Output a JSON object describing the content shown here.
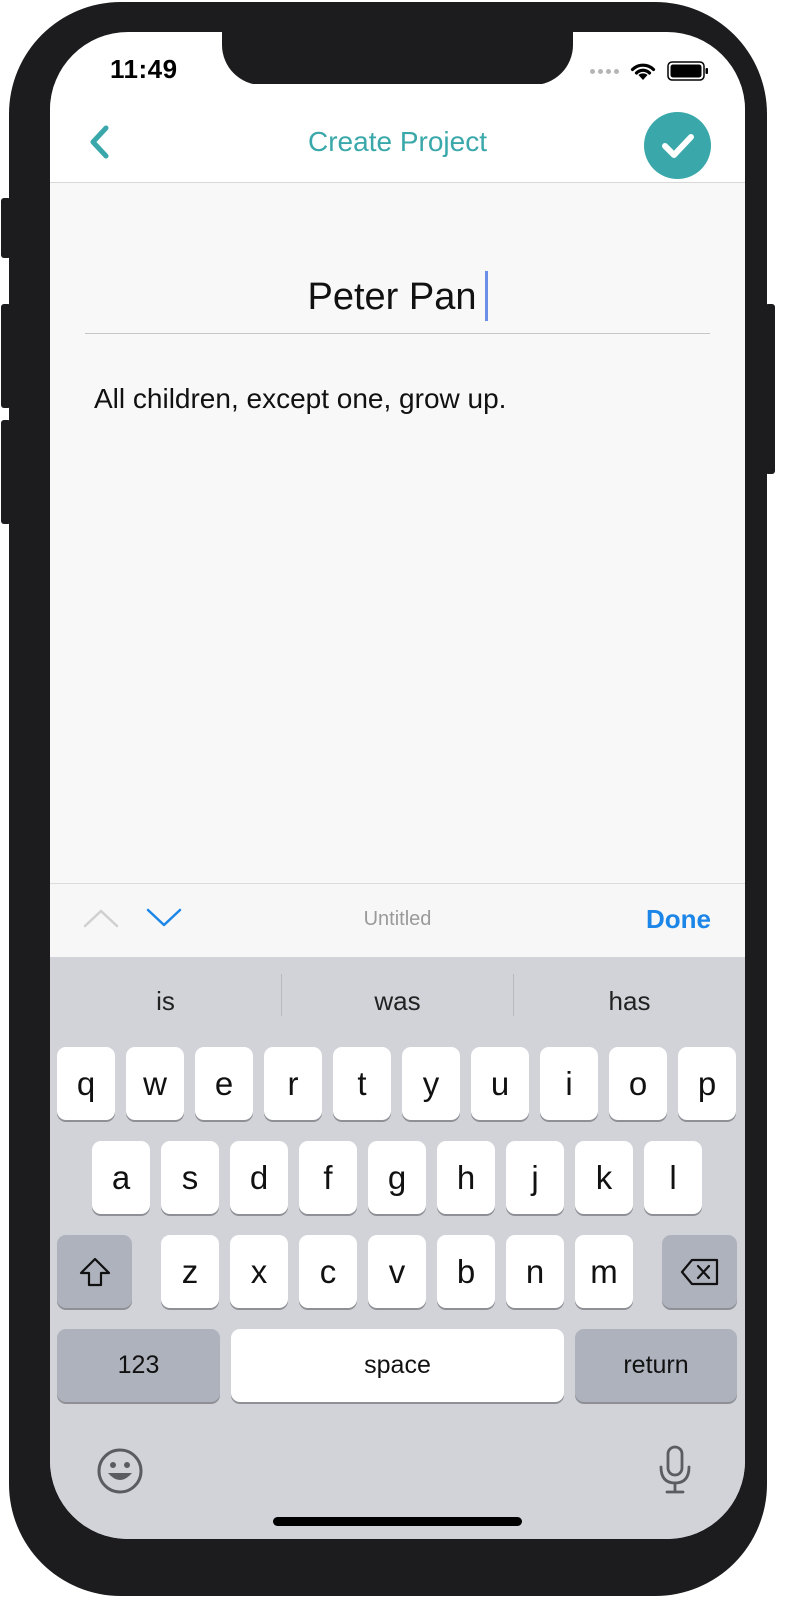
{
  "status_bar": {
    "time": "11:49"
  },
  "nav": {
    "title": "Create Project",
    "back_icon": "chevron-left-icon",
    "confirm_icon": "checkmark-icon"
  },
  "colors": {
    "accent": "#3aa8aa",
    "done_blue": "#1c86e8",
    "caret": "#6b8fe6"
  },
  "editor": {
    "title_value": "Peter Pan",
    "body_value": "All children, except one, grow up."
  },
  "accessory_bar": {
    "label": "Untitled",
    "done_label": "Done"
  },
  "keyboard": {
    "suggestions": [
      "is",
      "was",
      "has"
    ],
    "row1": [
      "q",
      "w",
      "e",
      "r",
      "t",
      "y",
      "u",
      "i",
      "o",
      "p"
    ],
    "row2": [
      "a",
      "s",
      "d",
      "f",
      "g",
      "h",
      "j",
      "k",
      "l"
    ],
    "row3": [
      "z",
      "x",
      "c",
      "v",
      "b",
      "n",
      "m"
    ],
    "numbers_label": "123",
    "space_label": "space",
    "return_label": "return"
  }
}
